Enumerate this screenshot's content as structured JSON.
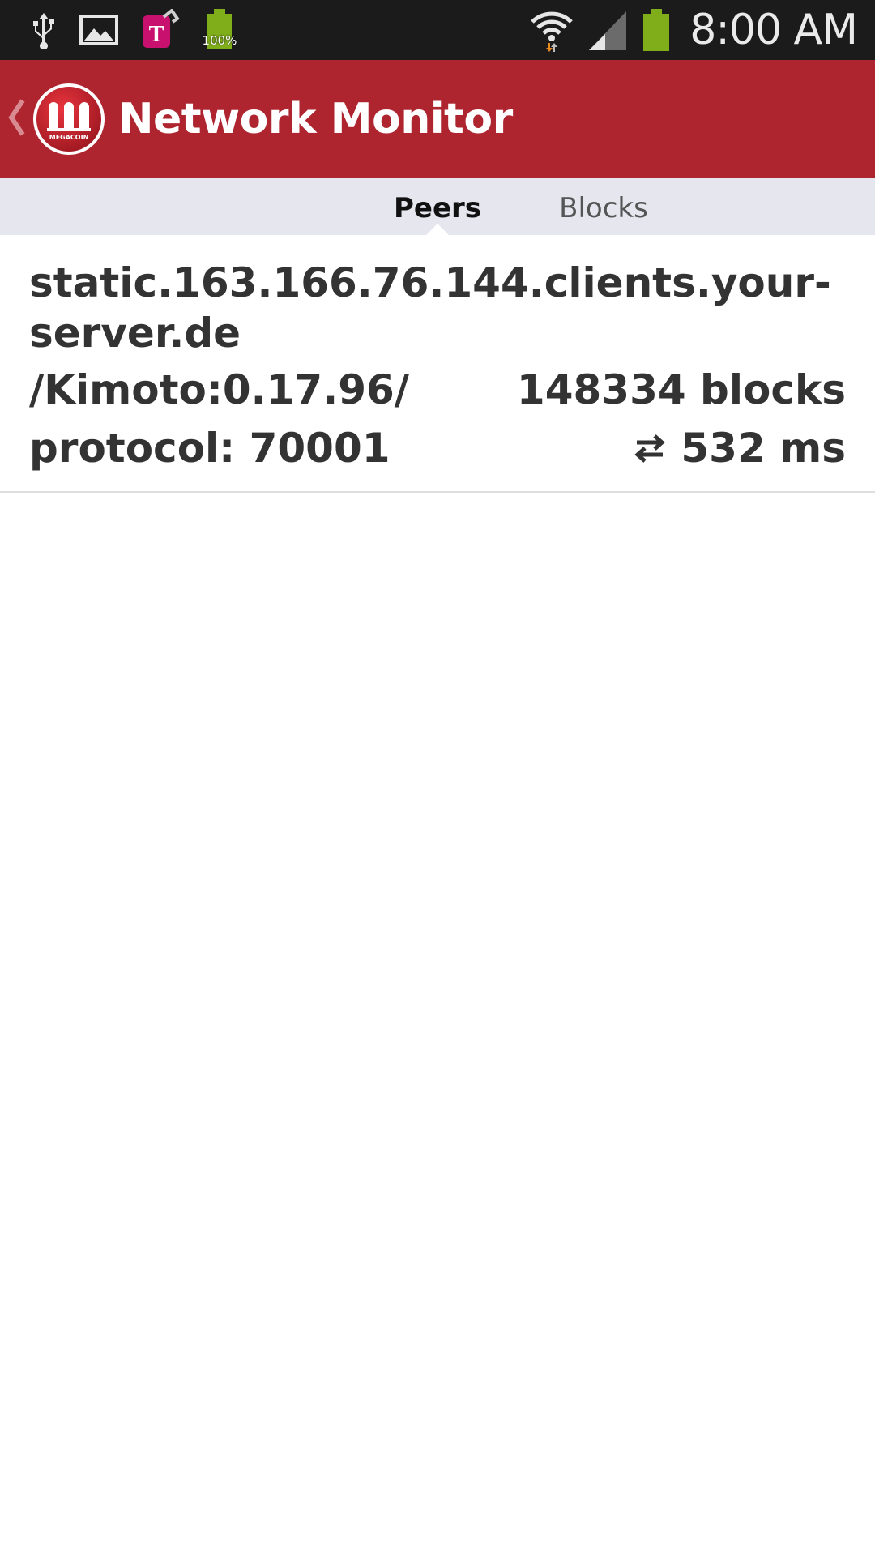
{
  "status_bar": {
    "clock": "8:00 AM",
    "battery_level": "100%",
    "icons": [
      "usb-icon",
      "image-icon",
      "tmobile-icon",
      "battery-widget-icon",
      "wifi-icon",
      "signal-icon",
      "battery-icon"
    ]
  },
  "action_bar": {
    "title": "Network Monitor",
    "logo_text": "MEGACOIN",
    "color": "#ae2530"
  },
  "tabs": [
    {
      "label": "Peers",
      "selected": true
    },
    {
      "label": "Blocks",
      "selected": false
    }
  ],
  "peers": [
    {
      "host": "static.163.166.76.144.clients.your-server.de",
      "version": "/Kimoto:0.17.96/",
      "height": "148334 blocks",
      "protocol": "protocol: 70001",
      "ping": "532 ms"
    }
  ]
}
